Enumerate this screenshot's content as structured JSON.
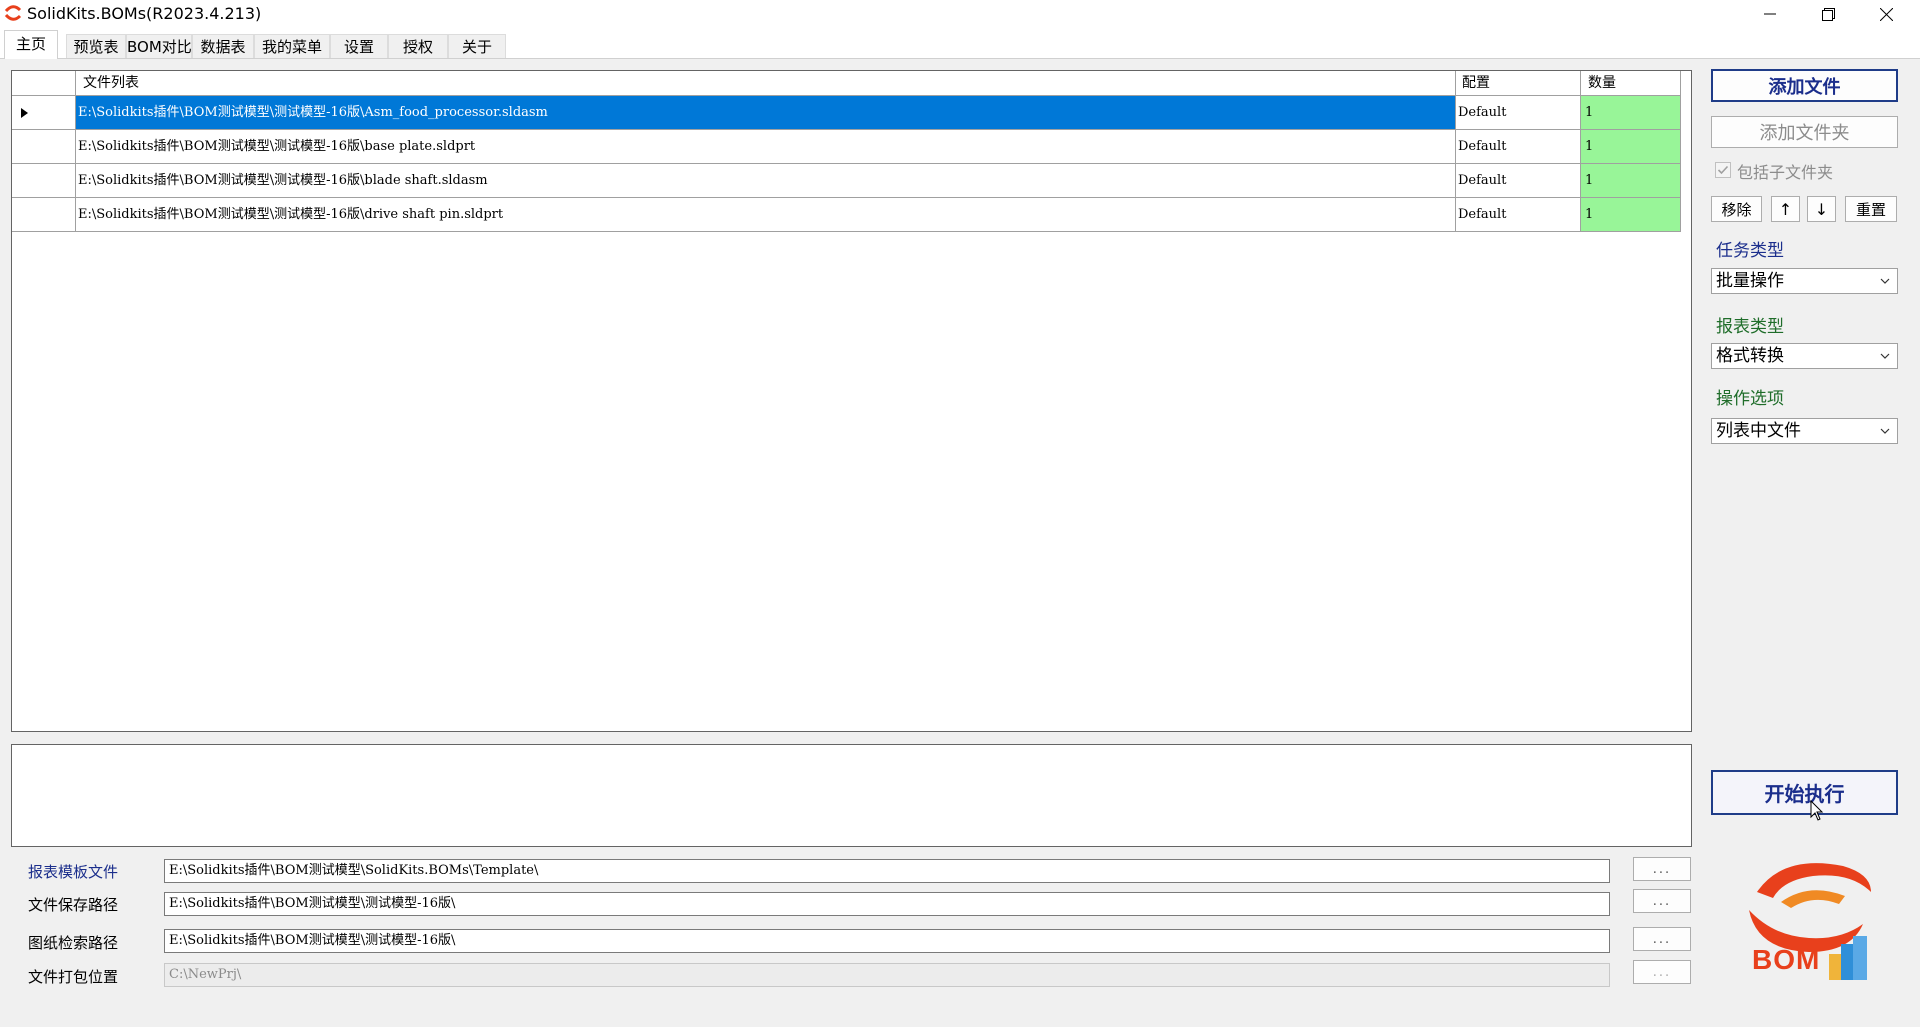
{
  "window": {
    "title": "SolidKits.BOMs(R2023.4.213)",
    "icons": [
      "app-logo-icon",
      "minimize-icon",
      "restore-icon",
      "close-icon"
    ]
  },
  "tabs": [
    {
      "label": "主页",
      "active": true
    },
    {
      "label": "预览表"
    },
    {
      "label": "BOM对比"
    },
    {
      "label": "数据表"
    },
    {
      "label": "我的菜单"
    },
    {
      "label": "设置"
    },
    {
      "label": "授权"
    },
    {
      "label": "关于"
    }
  ],
  "file_grid": {
    "columns": [
      "文件列表",
      "配置",
      "数量"
    ],
    "rows": [
      {
        "path": "E:\\Solidkits插件\\BOM测试模型\\测试模型-16版\\Asm_food_processor.sldasm",
        "config": "Default",
        "qty": "1",
        "selected": true
      },
      {
        "path": "E:\\Solidkits插件\\BOM测试模型\\测试模型-16版\\base plate.sldprt",
        "config": "Default",
        "qty": "1"
      },
      {
        "path": "E:\\Solidkits插件\\BOM测试模型\\测试模型-16版\\blade shaft.sldasm",
        "config": "Default",
        "qty": "1"
      },
      {
        "path": "E:\\Solidkits插件\\BOM测试模型\\测试模型-16版\\drive shaft pin.sldprt",
        "config": "Default",
        "qty": "1"
      }
    ]
  },
  "right_panel": {
    "add_file": "添加文件",
    "add_folder": "添加文件夹",
    "include_subfolders": "包括子文件夹",
    "include_subfolders_checked": true,
    "remove": "移除",
    "move_up": "↑",
    "move_down": "↓",
    "reset": "重置",
    "task_type_label": "任务类型",
    "task_type_value": "批量操作",
    "report_type_label": "报表类型",
    "report_type_value": "格式转换",
    "op_option_label": "操作选项",
    "op_option_value": "列表中文件",
    "start": "开始执行",
    "logo_text": "BOM"
  },
  "paths": [
    {
      "label": "报表模板文件",
      "value": "E:\\Solidkits插件\\BOM测试模型\\SolidKits.BOMs\\Template\\",
      "browse": "...",
      "highlight": true
    },
    {
      "label": "文件保存路径",
      "value": "E:\\Solidkits插件\\BOM测试模型\\测试模型-16版\\",
      "browse": "..."
    },
    {
      "label": "图纸检索路径",
      "value": "E:\\Solidkits插件\\BOM测试模型\\测试模型-16版\\",
      "browse": "..."
    },
    {
      "label": "文件打包位置",
      "value": "C:\\NewPrj\\",
      "browse": "...",
      "disabled": true
    }
  ],
  "colors": {
    "selection": "#0078d7",
    "qty_cell": "#98f598",
    "accent_blue": "#1b2e8c",
    "label_green": "#1f6d2a",
    "logo_red": "#e8401c"
  }
}
